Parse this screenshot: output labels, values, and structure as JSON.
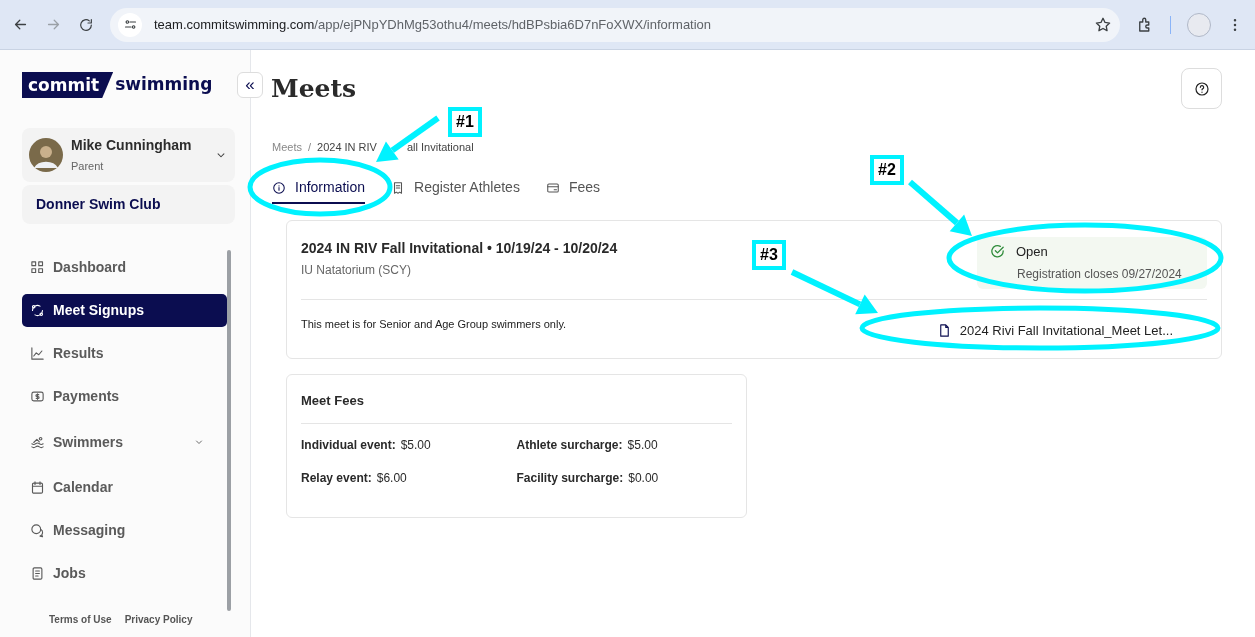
{
  "browser": {
    "url_host": "team.commitswimming.com",
    "url_path": "/app/ejPNpYDhMg53othu4/meets/hdBPsbia6D7nFoXWX/information"
  },
  "sidebar": {
    "logo": {
      "box_text": "commit",
      "text": "swimming"
    },
    "user": {
      "name": "Mike Cunningham",
      "role": "Parent"
    },
    "club": "Donner Swim Club",
    "items": [
      {
        "label": "Dashboard",
        "kind": "link",
        "selected": false
      },
      {
        "label": "Meet Signups",
        "kind": "link",
        "selected": true
      },
      {
        "label": "Results",
        "kind": "link",
        "selected": false
      },
      {
        "label": "Payments",
        "kind": "link",
        "selected": false
      },
      {
        "label": "Swimmers",
        "kind": "group",
        "selected": false
      },
      {
        "label": "Calendar",
        "kind": "link",
        "selected": false
      },
      {
        "label": "Messaging",
        "kind": "link",
        "selected": false
      },
      {
        "label": "Jobs",
        "kind": "link",
        "selected": false
      }
    ],
    "footer_links": [
      "Terms of Use",
      "Privacy Policy"
    ]
  },
  "collapse_button": "«",
  "page_title": "Meets",
  "breadcrumb": {
    "parent": "Meets",
    "separator": "/",
    "current_visible_parts": [
      "2024 IN RIV",
      "all Invitational"
    ]
  },
  "tabs": [
    {
      "label": "Information",
      "selected": true
    },
    {
      "label": "Register Athletes",
      "selected": false
    },
    {
      "label": "Fees",
      "selected": false
    }
  ],
  "meet": {
    "title": "2024 IN RIV Fall Invitational • 10/19/24 - 10/20/24",
    "venue": "IU Natatorium (SCY)",
    "status": "Open",
    "status_note": "Registration closes 09/27/2024",
    "description": "This meet is for Senior and Age Group swimmers only.",
    "document": "2024 Rivi Fall Invitational_Meet Let..."
  },
  "fees": {
    "title": "Meet Fees",
    "items": [
      {
        "label": "Individual event:",
        "value": "$5.00"
      },
      {
        "label": "Athlete surcharge:",
        "value": "$5.00"
      },
      {
        "label": "Relay event:",
        "value": "$6.00"
      },
      {
        "label": "Facility surcharge:",
        "value": "$0.00"
      }
    ]
  },
  "annotations": [
    {
      "label": "#1"
    },
    {
      "label": "#2"
    },
    {
      "label": "#3"
    }
  ]
}
